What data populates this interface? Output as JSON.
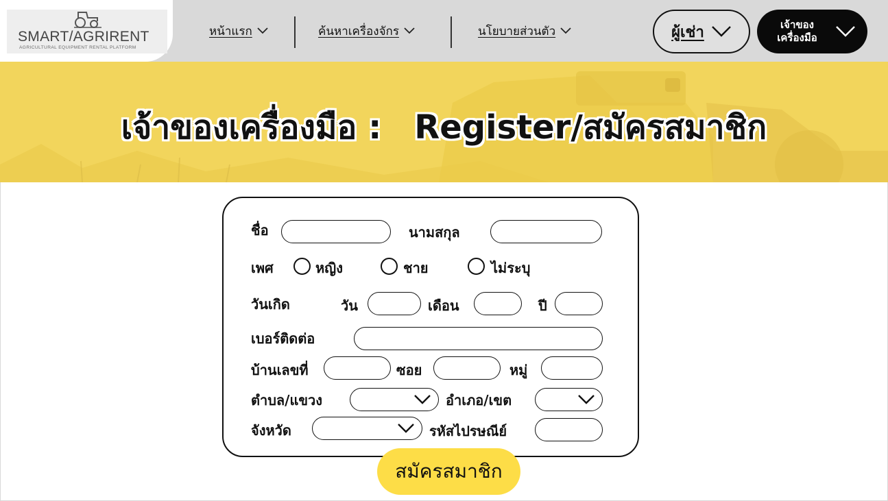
{
  "brand": {
    "name": "SMART/AGRIRENT",
    "tagline": "AGRICULTURAL EQUIPMENT RENTAL PLATFORM"
  },
  "nav": {
    "items": [
      {
        "label": "หน้าแรก"
      },
      {
        "label": "ค้นหาเครื่องจักร"
      },
      {
        "label": "นโยบายส่วนตัว"
      }
    ],
    "renter_label": "ผู้เช่า",
    "owner_label_line1": "เจ้าของ",
    "owner_label_line2": "เครื่องมือ"
  },
  "banner": {
    "title_left": "เจ้าของเครื่องมือ :",
    "title_right": "Register/สมัครสมาชิก"
  },
  "form": {
    "first_name_label": "ชื่อ",
    "last_name_label": "นามสกุล",
    "gender_label": "เพศ",
    "gender_options": [
      "หญิง",
      "ชาย",
      "ไม่ระบุ"
    ],
    "birthdate_label": "วันเกิด",
    "day_label": "วัน",
    "month_label": "เดือน",
    "year_label": "ปี",
    "phone_label": "เบอร์ติดต่อ",
    "house_no_label": "บ้านเลขที่",
    "soi_label": "ซอย",
    "moo_label": "หมู่",
    "subdistrict_label": "ตำบล/แขวง",
    "district_label": "อำเภอ/เขต",
    "province_label": "จังหวัด",
    "postcode_label": "รหัสไปรษณีย์",
    "submit_label": "สมัครสมาชิก"
  }
}
